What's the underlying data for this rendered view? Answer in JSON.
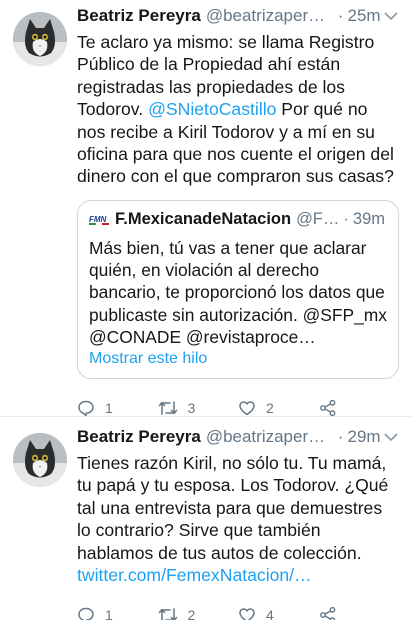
{
  "tweets": [
    {
      "author": "Beatriz Pereyra",
      "handle": "@beatrizapere…",
      "time": "25m",
      "text_before": "Te aclaro ya mismo: se llama Registro Público de la Propiedad ahí están registradas las propiedades de los Todorov. ",
      "mention": "@SNietoCastillo",
      "text_after": " Por qué no nos recibe a Kiril Todorov y a mí en su oficina para que nos cuente el origen del dinero con el que compraron sus casas?",
      "quote": {
        "author": "F.MexicanadeNatacion",
        "handle": "@F…",
        "time": "39m",
        "text": "Más bien, tú vas a tener que aclarar quién, en violación al derecho bancario, te proporcionó los datos que publicaste sin autorización. @SFP_mx @CONADE @revistaproce…",
        "show_thread": "Mostrar este hilo"
      },
      "actions": {
        "replies": "1",
        "retweets": "3",
        "likes": "2"
      }
    },
    {
      "author": "Beatriz Pereyra",
      "handle": "@beatrizapere…",
      "time": "29m",
      "text": "Tienes razón Kiril,  no sólo tu. Tu mamá, tu papá y tu esposa. Los Todorov. ¿Qué tal una entrevista para que demuestres lo contrario? Sirve que también hablamos de tus autos de colección. ",
      "link": "twitter.com/FemexNatacion/…",
      "actions": {
        "replies": "1",
        "retweets": "2",
        "likes": "4"
      }
    }
  ],
  "icons": {
    "reply": "reply-icon",
    "retweet": "retweet-icon",
    "like": "heart-icon",
    "share": "share-icon",
    "caret": "chevron-down-icon"
  },
  "colors": {
    "link": "#1da1f2",
    "secondary": "#657786",
    "border": "#ccd6dd"
  }
}
